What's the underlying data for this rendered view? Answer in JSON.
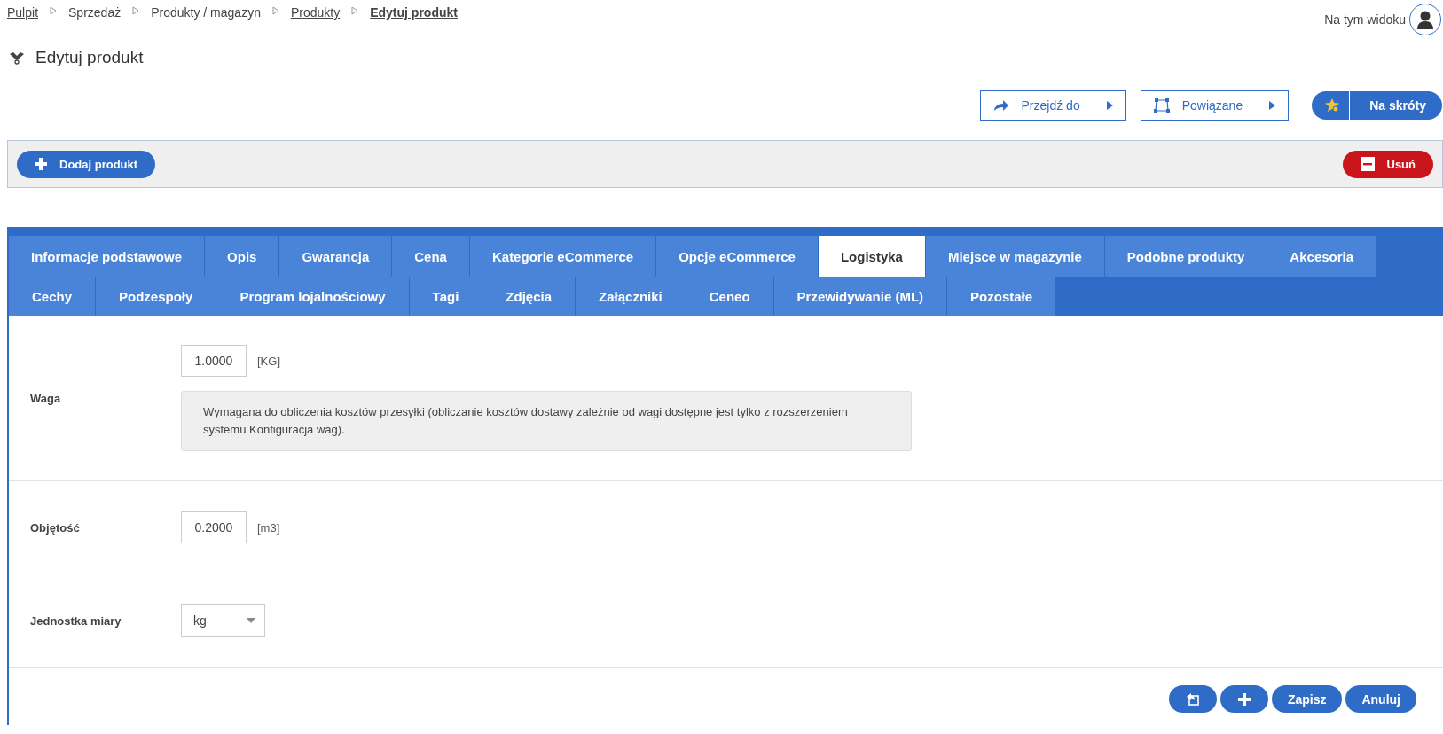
{
  "breadcrumb": [
    {
      "label": "Pulpit",
      "kind": "link",
      "current": false
    },
    {
      "label": "Sprzedaż",
      "kind": "text",
      "current": false
    },
    {
      "label": "Produkty / magazyn",
      "kind": "text",
      "current": false
    },
    {
      "label": "Produkty",
      "kind": "link",
      "current": false
    },
    {
      "label": "Edytuj produkt",
      "kind": "link",
      "current": true
    }
  ],
  "view_label": "Na tym widoku",
  "page_title": "Edytuj produkt",
  "action_buttons": [
    {
      "label": "Przejdź do",
      "kind": "goto"
    },
    {
      "label": "Powiązane",
      "kind": "related"
    }
  ],
  "shortcuts_button": "Na skróty",
  "toolbar": {
    "add_button": "Dodaj produkt",
    "delete_button": "Usuń"
  },
  "tabs": [
    [
      {
        "label": "Informacje podstawowe",
        "selected": false
      },
      {
        "label": "Opis",
        "selected": false
      },
      {
        "label": "Gwarancja",
        "selected": false
      },
      {
        "label": "Cena",
        "selected": false
      },
      {
        "label": "Kategorie eCommerce",
        "selected": false
      },
      {
        "label": "Opcje eCommerce",
        "selected": false
      },
      {
        "label": "Logistyka",
        "selected": true
      },
      {
        "label": "Miejsce w magazynie",
        "selected": false
      },
      {
        "label": "Podobne produkty",
        "selected": false
      },
      {
        "label": "Akcesoria",
        "selected": false
      }
    ],
    [
      {
        "label": "Cechy",
        "selected": false
      },
      {
        "label": "Podzespoły",
        "selected": false
      },
      {
        "label": "Program lojalnościowy",
        "selected": false
      },
      {
        "label": "Tagi",
        "selected": false
      },
      {
        "label": "Zdjęcia",
        "selected": false
      },
      {
        "label": "Załączniki",
        "selected": false
      },
      {
        "label": "Ceneo",
        "selected": false
      },
      {
        "label": "Przewidywanie (ML)",
        "selected": false
      },
      {
        "label": "Pozostałe",
        "selected": false
      }
    ]
  ],
  "fields": [
    {
      "label": "Waga",
      "kind": "number",
      "value": "1.0000",
      "unit": "[KG]",
      "hint": "Wymagana do obliczenia kosztów przesyłki (obliczanie kosztów dostawy zależnie od wagi dostępne jest tylko z rozszerzeniem systemu Konfiguracja wag)."
    },
    {
      "label": "Objętość",
      "kind": "number",
      "value": "0.2000",
      "unit": "[m3]"
    },
    {
      "label": "Jednostka miary",
      "kind": "select",
      "value": "kg"
    }
  ],
  "footer_buttons": [
    {
      "kind": "back-icon"
    },
    {
      "kind": "add-icon"
    },
    {
      "kind": "text",
      "label": "Zapisz"
    },
    {
      "kind": "text",
      "label": "Anuluj"
    }
  ]
}
